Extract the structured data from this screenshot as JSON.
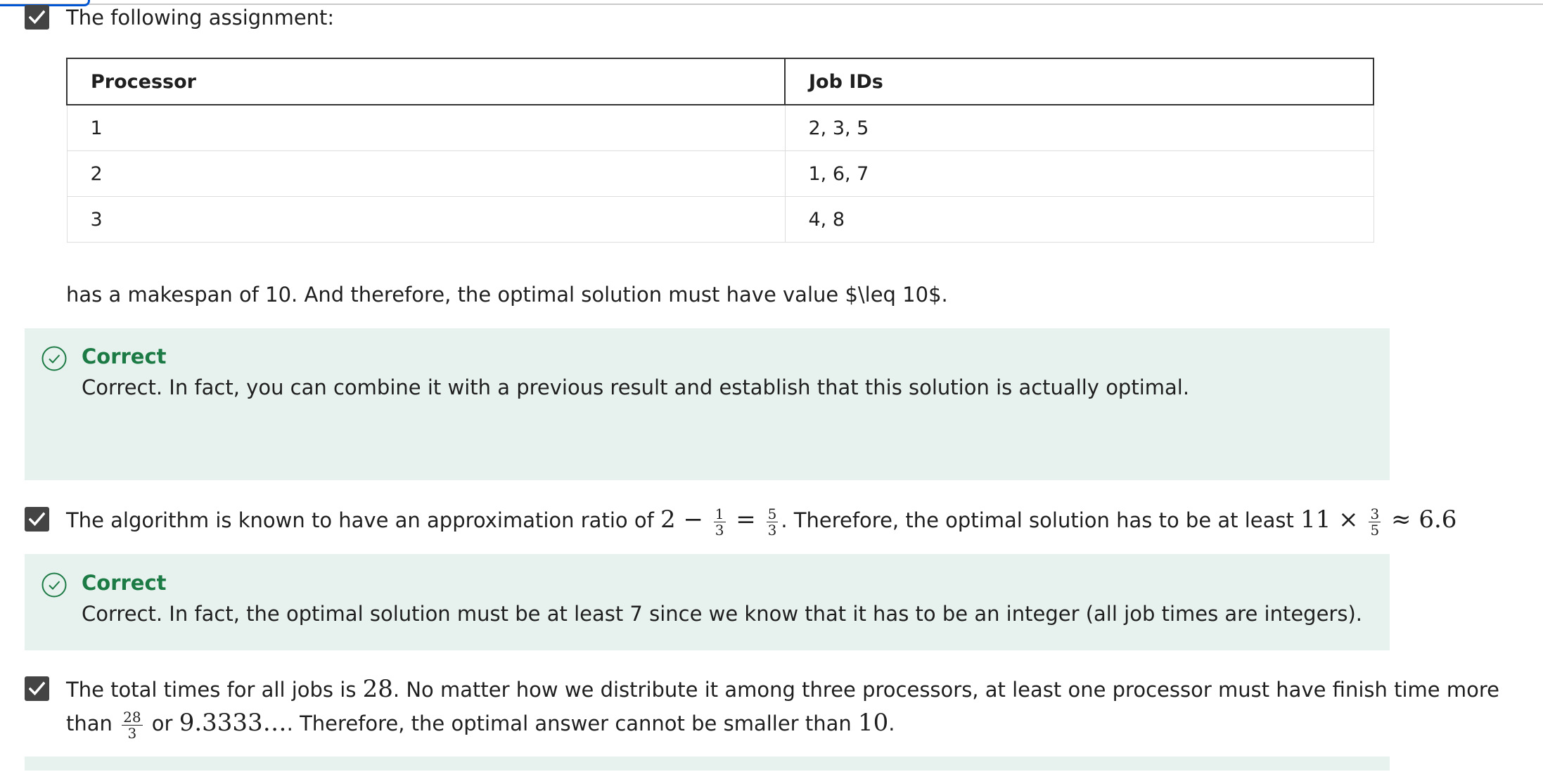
{
  "q1": {
    "intro": "The following assignment:",
    "table": {
      "headers": [
        "Processor",
        "Job IDs"
      ],
      "rows": [
        [
          "1",
          "2, 3, 5"
        ],
        [
          "2",
          "1, 6, 7"
        ],
        [
          "3",
          "4, 8"
        ]
      ]
    },
    "after_text": "has a makespan of 10. And therefore, the optimal solution must have value $\\leq 10$.",
    "feedback": {
      "title": "Correct",
      "body": "Correct. In fact, you can combine it with a previous result and establish that this solution is actually optimal."
    }
  },
  "q2": {
    "text_a": "The algorithm is known to have an approximation ratio of ",
    "math_2": "2",
    "math_minus": " − ",
    "frac_1_num": "1",
    "frac_1_den": "3",
    "math_eq": " = ",
    "frac_2_num": "5",
    "frac_2_den": "3",
    "text_b": ". Therefore, the optimal solution has to be at least ",
    "math_11": "11",
    "math_times": " × ",
    "frac_3_num": "3",
    "frac_3_den": "5",
    "math_approx": " ≈ 6.6",
    "feedback": {
      "title": "Correct",
      "body": "Correct. In fact, the optimal solution must be at least 7 since we know that it has to be an integer (all job times are integers)."
    }
  },
  "q3": {
    "line1_a": "The total times for all jobs is ",
    "math_28": "28",
    "line1_b": ". No matter how we distribute it among three processors, at least one processor must have finish time more",
    "line2_a": "than ",
    "frac_num": "28",
    "frac_den": "3",
    "line2_b": " or ",
    "math_9333": "9.3333…",
    "line2_c": ". Therefore, the optimal answer cannot be smaller than ",
    "math_10": "10",
    "line2_d": "."
  },
  "colors": {
    "feedback_bg": "#e7f2ee",
    "correct_green": "#1c7a45",
    "checkbox": "#444444",
    "focus_blue": "#0056d2"
  },
  "icons": [
    "check-icon",
    "check-circle-icon"
  ]
}
